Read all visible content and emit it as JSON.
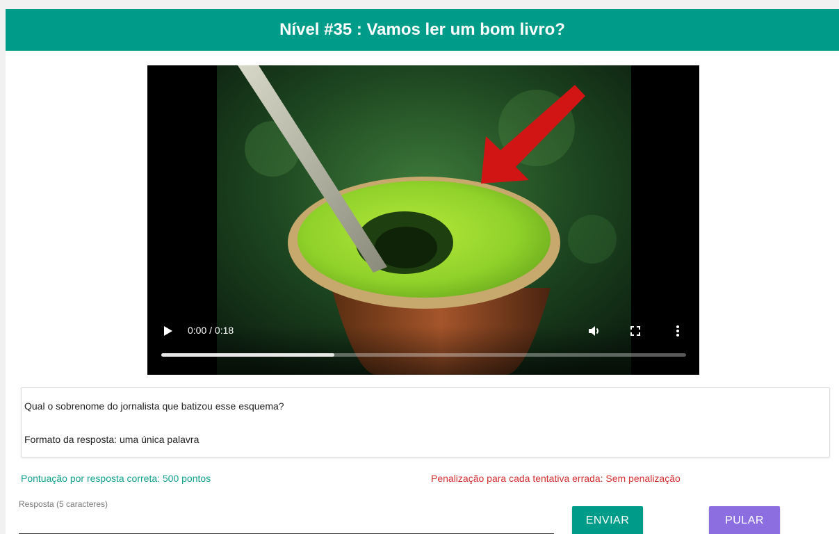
{
  "header": {
    "title": "Nível #35 : Vamos ler um bom livro?"
  },
  "video": {
    "time": "0:00 / 0:18",
    "progress": 0.33,
    "play_icon": "play-icon",
    "volume_icon": "volume-icon",
    "fullscreen_icon": "fullscreen-icon",
    "more_icon": "more-vert-icon"
  },
  "question": {
    "line1": "Qual o sobrenome do jornalista que batizou esse esquema?",
    "line2": "Formato da resposta: uma única palavra"
  },
  "info": {
    "score": "Pontuação por resposta correta: 500 pontos",
    "penalty": "Penalização para cada tentativa errada: Sem penalização"
  },
  "answer": {
    "label": "Resposta (5 caracteres)",
    "value": "",
    "placeholder": ""
  },
  "buttons": {
    "send": "ENVIAR",
    "skip": "PULAR"
  },
  "colors": {
    "header": "#009c8a",
    "score_text": "#12a08d",
    "penalty_text": "#d32f2f",
    "send_button": "#009c8a",
    "skip_button": "#8c6ee0"
  }
}
